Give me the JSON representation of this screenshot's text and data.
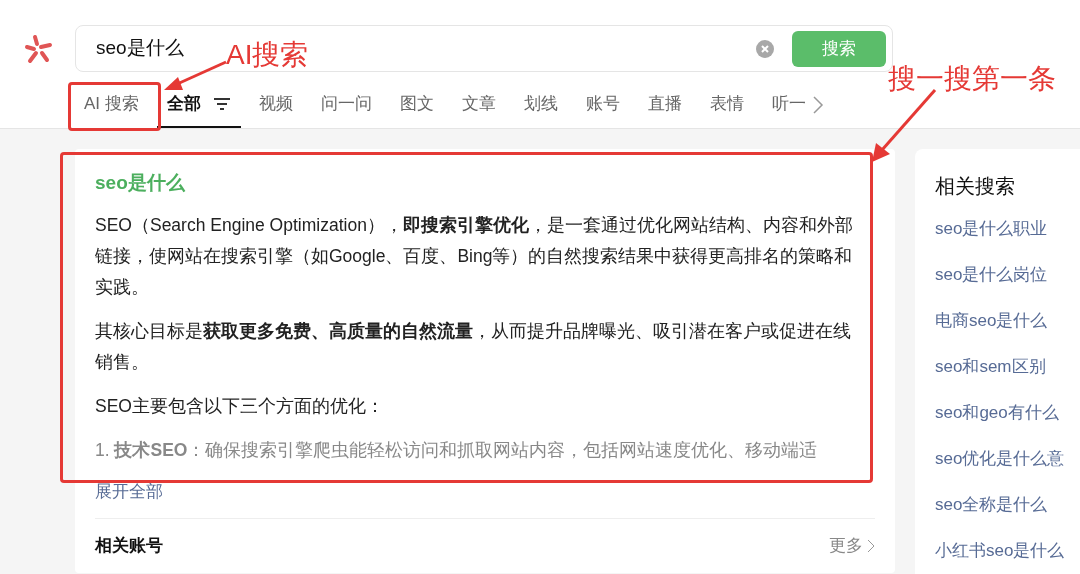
{
  "search": {
    "value": "seo是什么",
    "button": "搜索"
  },
  "tabs": [
    {
      "label": "AI 搜索",
      "selected": false,
      "kind": "ai"
    },
    {
      "label": "全部",
      "selected": true,
      "kind": "filter"
    },
    {
      "label": "视频",
      "selected": false,
      "kind": "plain"
    },
    {
      "label": "问一问",
      "selected": false,
      "kind": "plain"
    },
    {
      "label": "图文",
      "selected": false,
      "kind": "plain"
    },
    {
      "label": "文章",
      "selected": false,
      "kind": "plain"
    },
    {
      "label": "划线",
      "selected": false,
      "kind": "plain"
    },
    {
      "label": "账号",
      "selected": false,
      "kind": "plain"
    },
    {
      "label": "直播",
      "selected": false,
      "kind": "plain"
    },
    {
      "label": "表情",
      "selected": false,
      "kind": "plain"
    },
    {
      "label": "听一",
      "selected": false,
      "kind": "plain"
    }
  ],
  "result": {
    "title": "seo是什么",
    "paragraphs": [
      "SEO（Search Engine Optimization），**即搜索引擎优化**，是一套通过优化网站结构、内容和外部链接，使网站在搜索引擎（如Google、百度、Bing等）的自然搜索结果中获得更高排名的策略和实践。",
      "其核心目标是**获取更多免费、高质量的自然流量**，从而提升品牌曝光、吸引潜在客户或促进在线销售。",
      "SEO主要包含以下三个方面的优化：",
      "1. **技术SEO**：确保搜索引擎爬虫能轻松访问和抓取网站内容，包括网站速度优化、移动端适"
    ],
    "expand": "展开全部"
  },
  "related_accounts": {
    "title": "相关账号",
    "more": "更多"
  },
  "related_searches": {
    "title": "相关搜索",
    "items": [
      "seo是什么职业",
      "seo是什么岗位",
      "电商seo是什么",
      "seo和sem区别",
      "seo和geo有什么",
      "seo优化是什么意",
      "seo全称是什么",
      "小红书seo是什么"
    ]
  },
  "annotations": [
    {
      "text": "AI搜索"
    },
    {
      "text": "搜一搜第一条"
    }
  ]
}
